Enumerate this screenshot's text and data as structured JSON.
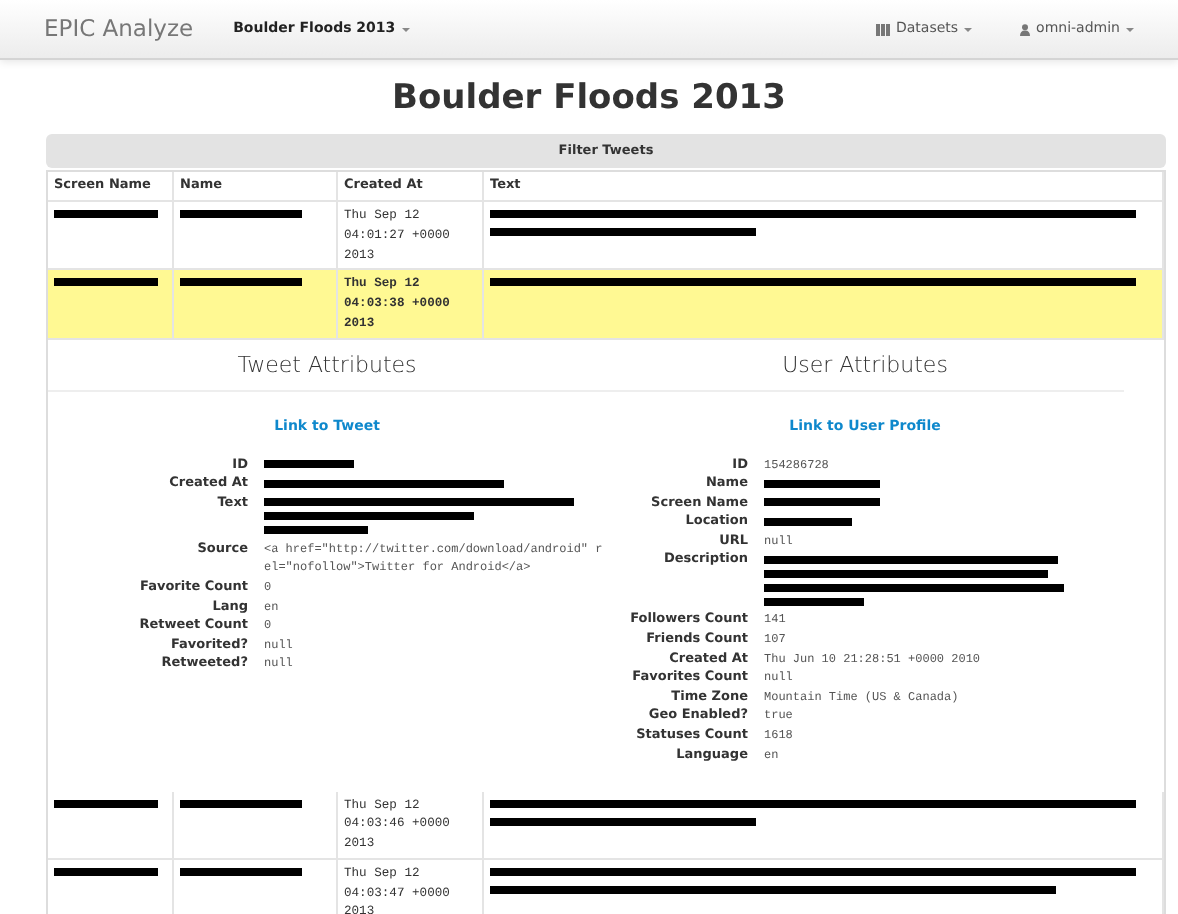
{
  "navbar": {
    "brand": "EPIC Analyze",
    "dataset_menu": "Boulder Floods 2013",
    "datasets_menu": "Datasets",
    "user_menu": "omni-admin"
  },
  "title": "Boulder Floods 2013",
  "filter_bar": "Filter Tweets",
  "table": {
    "columns": [
      "Screen Name",
      "Name",
      "Created At",
      "Text"
    ],
    "rows": [
      {
        "created_at": "Thu Sep 12 04:01:27 +0000 2013",
        "selected": false
      },
      {
        "created_at": "Thu Sep 12 04:03:38 +0000 2013",
        "selected": true
      },
      {
        "created_at": "Thu Sep 12 04:03:46 +0000 2013",
        "selected": false
      },
      {
        "created_at": "Thu Sep 12 04:03:47 +0000 2013",
        "selected": false
      }
    ]
  },
  "details": [
    {
      "heading": "Tweet Attributes",
      "link": "Link to Tweet",
      "fields": [
        {
          "label": "ID",
          "kind": "redacted"
        },
        {
          "label": "Created At",
          "kind": "redacted"
        },
        {
          "label": "Text",
          "kind": "redacted"
        },
        {
          "label": "Source",
          "kind": "text",
          "value": "<a href=\"http://twitter.com/download/android\" rel=\"nofollow\">Twitter for Android</a>"
        },
        {
          "label": "Favorite Count",
          "kind": "text",
          "value": "0"
        },
        {
          "label": "Lang",
          "kind": "text",
          "value": "en"
        },
        {
          "label": "Retweet Count",
          "kind": "text",
          "value": "0"
        },
        {
          "label": "Favorited?",
          "kind": "text",
          "value": "null"
        },
        {
          "label": "Retweeted?",
          "kind": "text",
          "value": "null"
        }
      ]
    },
    {
      "heading": "User Attributes",
      "link": "Link to User Profile",
      "fields": [
        {
          "label": "ID",
          "kind": "text",
          "value": "154286728"
        },
        {
          "label": "Name",
          "kind": "redacted"
        },
        {
          "label": "Screen Name",
          "kind": "redacted"
        },
        {
          "label": "Location",
          "kind": "redacted"
        },
        {
          "label": "URL",
          "kind": "text",
          "value": "null"
        },
        {
          "label": "Description",
          "kind": "redacted"
        },
        {
          "label": "Followers Count",
          "kind": "text",
          "value": "141"
        },
        {
          "label": "Friends Count",
          "kind": "text",
          "value": "107"
        },
        {
          "label": "Created At",
          "kind": "text",
          "value": "Thu Jun 10 21:28:51 +0000 2010"
        },
        {
          "label": "Favorites Count",
          "kind": "text",
          "value": "null"
        },
        {
          "label": "Time Zone",
          "kind": "text",
          "value": "Mountain Time (US & Canada)"
        },
        {
          "label": "Geo Enabled?",
          "kind": "text",
          "value": "true"
        },
        {
          "label": "Statuses Count",
          "kind": "text",
          "value": "1618"
        },
        {
          "label": "Language",
          "kind": "text",
          "value": "en"
        }
      ]
    }
  ]
}
